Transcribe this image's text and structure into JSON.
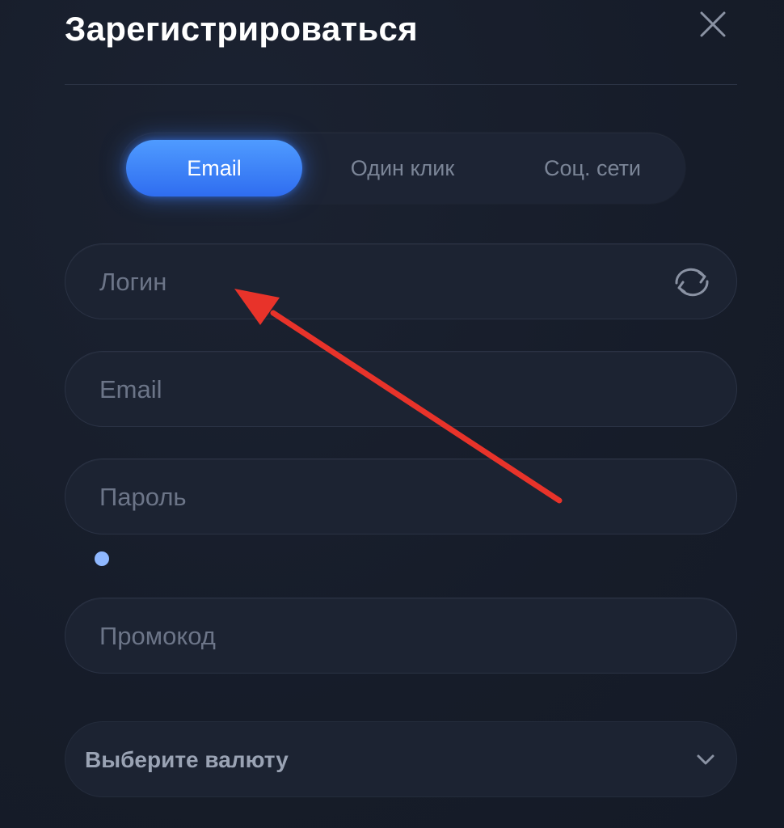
{
  "header": {
    "title": "Зарегистрироваться"
  },
  "tabs": [
    {
      "label": "Email",
      "active": true
    },
    {
      "label": "Один клик",
      "active": false
    },
    {
      "label": "Соц. сети",
      "active": false
    }
  ],
  "fields": {
    "login": {
      "placeholder": "Логин",
      "value": ""
    },
    "email": {
      "placeholder": "Email",
      "value": ""
    },
    "password": {
      "placeholder": "Пароль",
      "value": ""
    },
    "promo": {
      "placeholder": "Промокод",
      "value": ""
    }
  },
  "currency_select": {
    "label": "Выберите валюту"
  },
  "icons": {
    "close": "close-icon",
    "refresh": "refresh-icon",
    "chevron": "chevron-down-icon",
    "annotation_arrow": "annotation-arrow"
  },
  "colors": {
    "background": "#171d2b",
    "accent": "#3a7dff",
    "field_bg": "#1c2332",
    "placeholder": "#6c7588",
    "annotation": "#e8332a",
    "dot": "#8fb8ff"
  }
}
